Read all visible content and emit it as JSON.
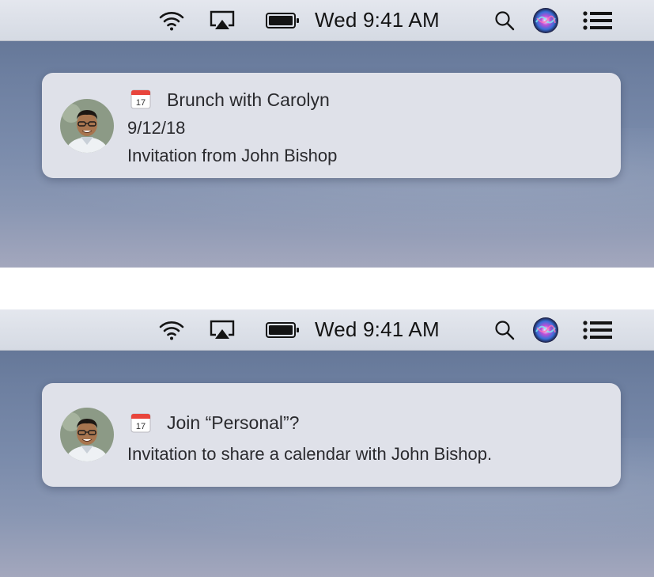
{
  "menubar": {
    "clock": "Wed 9:41 AM",
    "icons": [
      "wifi-icon",
      "airplay-icon",
      "battery-icon",
      "spotlight-search-icon",
      "siri-icon",
      "notification-center-icon"
    ]
  },
  "notifications": [
    {
      "app_icon": "calendar-icon",
      "calendar_icon_day": "17",
      "title": "Brunch with Carolyn",
      "lines": [
        "9/12/18",
        "Invitation from John Bishop"
      ]
    },
    {
      "app_icon": "calendar-icon",
      "calendar_icon_day": "17",
      "title": "Join “Personal”?",
      "lines": [
        "Invitation to share a calendar with John Bishop."
      ]
    }
  ],
  "colors": {
    "menubar": "#dde1e8",
    "notification_bg": "#dfe1e9",
    "desktop": "#6d7fa0",
    "calendar_red": "#e8453c"
  }
}
